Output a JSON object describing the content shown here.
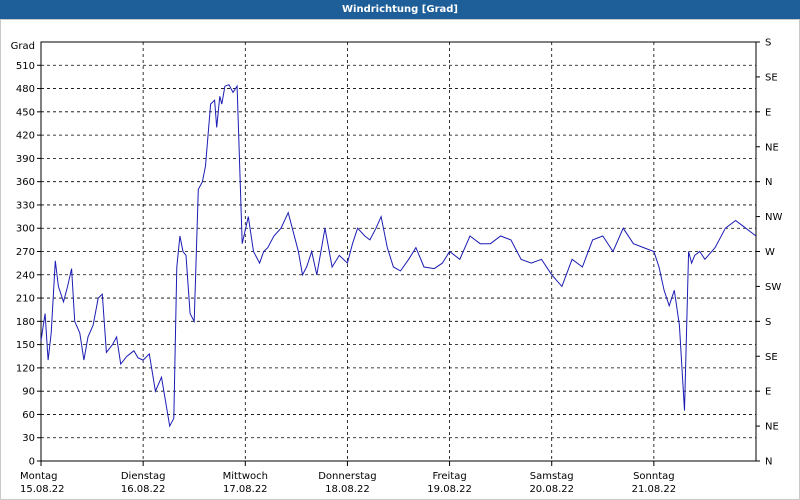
{
  "window": {
    "title": "Windrichtung [Grad]"
  },
  "chart_data": {
    "type": "line",
    "title": "Windrichtung [Grad]",
    "ylabel": "Grad",
    "ylim": [
      0,
      540
    ],
    "yticks": [
      0,
      30,
      60,
      90,
      120,
      150,
      180,
      210,
      240,
      270,
      300,
      330,
      360,
      390,
      420,
      450,
      480,
      510
    ],
    "right_axis_labels": [
      "N",
      "NE",
      "E",
      "SE",
      "S",
      "SW",
      "W",
      "NW",
      "N",
      "NE",
      "E",
      "SE",
      "S"
    ],
    "right_axis_values": [
      0,
      45,
      90,
      135,
      180,
      225,
      270,
      315,
      360,
      405,
      450,
      495,
      540
    ],
    "xlim": [
      0,
      7
    ],
    "xticks": [
      {
        "x": 0,
        "day": "Montag",
        "date": "15.08.22"
      },
      {
        "x": 1,
        "day": "Dienstag",
        "date": "16.08.22"
      },
      {
        "x": 2,
        "day": "Mittwoch",
        "date": "17.08.22"
      },
      {
        "x": 3,
        "day": "Donnerstag",
        "date": "18.08.22"
      },
      {
        "x": 4,
        "day": "Freitag",
        "date": "19.08.22"
      },
      {
        "x": 5,
        "day": "Samstag",
        "date": "20.08.22"
      },
      {
        "x": 6,
        "day": "Sonntag",
        "date": "21.08.22"
      }
    ],
    "grid": true,
    "line_color": "#1c1cb4",
    "series": [
      {
        "x": [
          0.0,
          0.04,
          0.07,
          0.1,
          0.14,
          0.17,
          0.22,
          0.26,
          0.3,
          0.33,
          0.38,
          0.42,
          0.46,
          0.51,
          0.56,
          0.6,
          0.64,
          0.7,
          0.74,
          0.78,
          0.84,
          0.91,
          0.95,
          1.0,
          1.06,
          1.12,
          1.18,
          1.26,
          1.3,
          1.33,
          1.36,
          1.39,
          1.42,
          1.46,
          1.5,
          1.54,
          1.58,
          1.61,
          1.66,
          1.7,
          1.72,
          1.75,
          1.77,
          1.8,
          1.84,
          1.88,
          1.92,
          1.97,
          2.03,
          2.08,
          2.14,
          2.18,
          2.22,
          2.28,
          2.35,
          2.42,
          2.46,
          2.52,
          2.56,
          2.6,
          2.65,
          2.7,
          2.78,
          2.85,
          2.92,
          3.0,
          3.05,
          3.1,
          3.17,
          3.22,
          3.28,
          3.33,
          3.39,
          3.45,
          3.52,
          3.6,
          3.67,
          3.75,
          3.85,
          3.93,
          4.0,
          4.1,
          4.2,
          4.3,
          4.4,
          4.5,
          4.6,
          4.7,
          4.8,
          4.9,
          5.0,
          5.1,
          5.2,
          5.3,
          5.4,
          5.5,
          5.6,
          5.7,
          5.8,
          5.9,
          6.0,
          6.05,
          6.1,
          6.15,
          6.2,
          6.25,
          6.3,
          6.34,
          6.37,
          6.4,
          6.45,
          6.5,
          6.6,
          6.7,
          6.8,
          6.85,
          6.9,
          6.95,
          7.0
        ],
        "values": [
          155,
          190,
          130,
          165,
          258,
          225,
          205,
          225,
          248,
          180,
          165,
          130,
          160,
          175,
          210,
          215,
          140,
          150,
          160,
          125,
          135,
          142,
          133,
          130,
          138,
          90,
          108,
          45,
          55,
          250,
          290,
          270,
          265,
          190,
          180,
          350,
          360,
          380,
          460,
          465,
          430,
          470,
          460,
          483,
          485,
          475,
          483,
          280,
          315,
          270,
          255,
          270,
          275,
          290,
          300,
          320,
          300,
          270,
          240,
          250,
          270,
          240,
          300,
          250,
          265,
          255,
          280,
          300,
          290,
          285,
          300,
          315,
          275,
          250,
          245,
          260,
          275,
          250,
          248,
          255,
          270,
          260,
          290,
          280,
          280,
          290,
          285,
          260,
          255,
          260,
          240,
          225,
          260,
          250,
          285,
          290,
          270,
          300,
          280,
          275,
          270,
          250,
          220,
          200,
          220,
          175,
          65,
          270,
          255,
          265,
          270,
          260,
          275,
          300,
          310,
          305,
          300,
          295,
          290
        ]
      }
    ]
  }
}
